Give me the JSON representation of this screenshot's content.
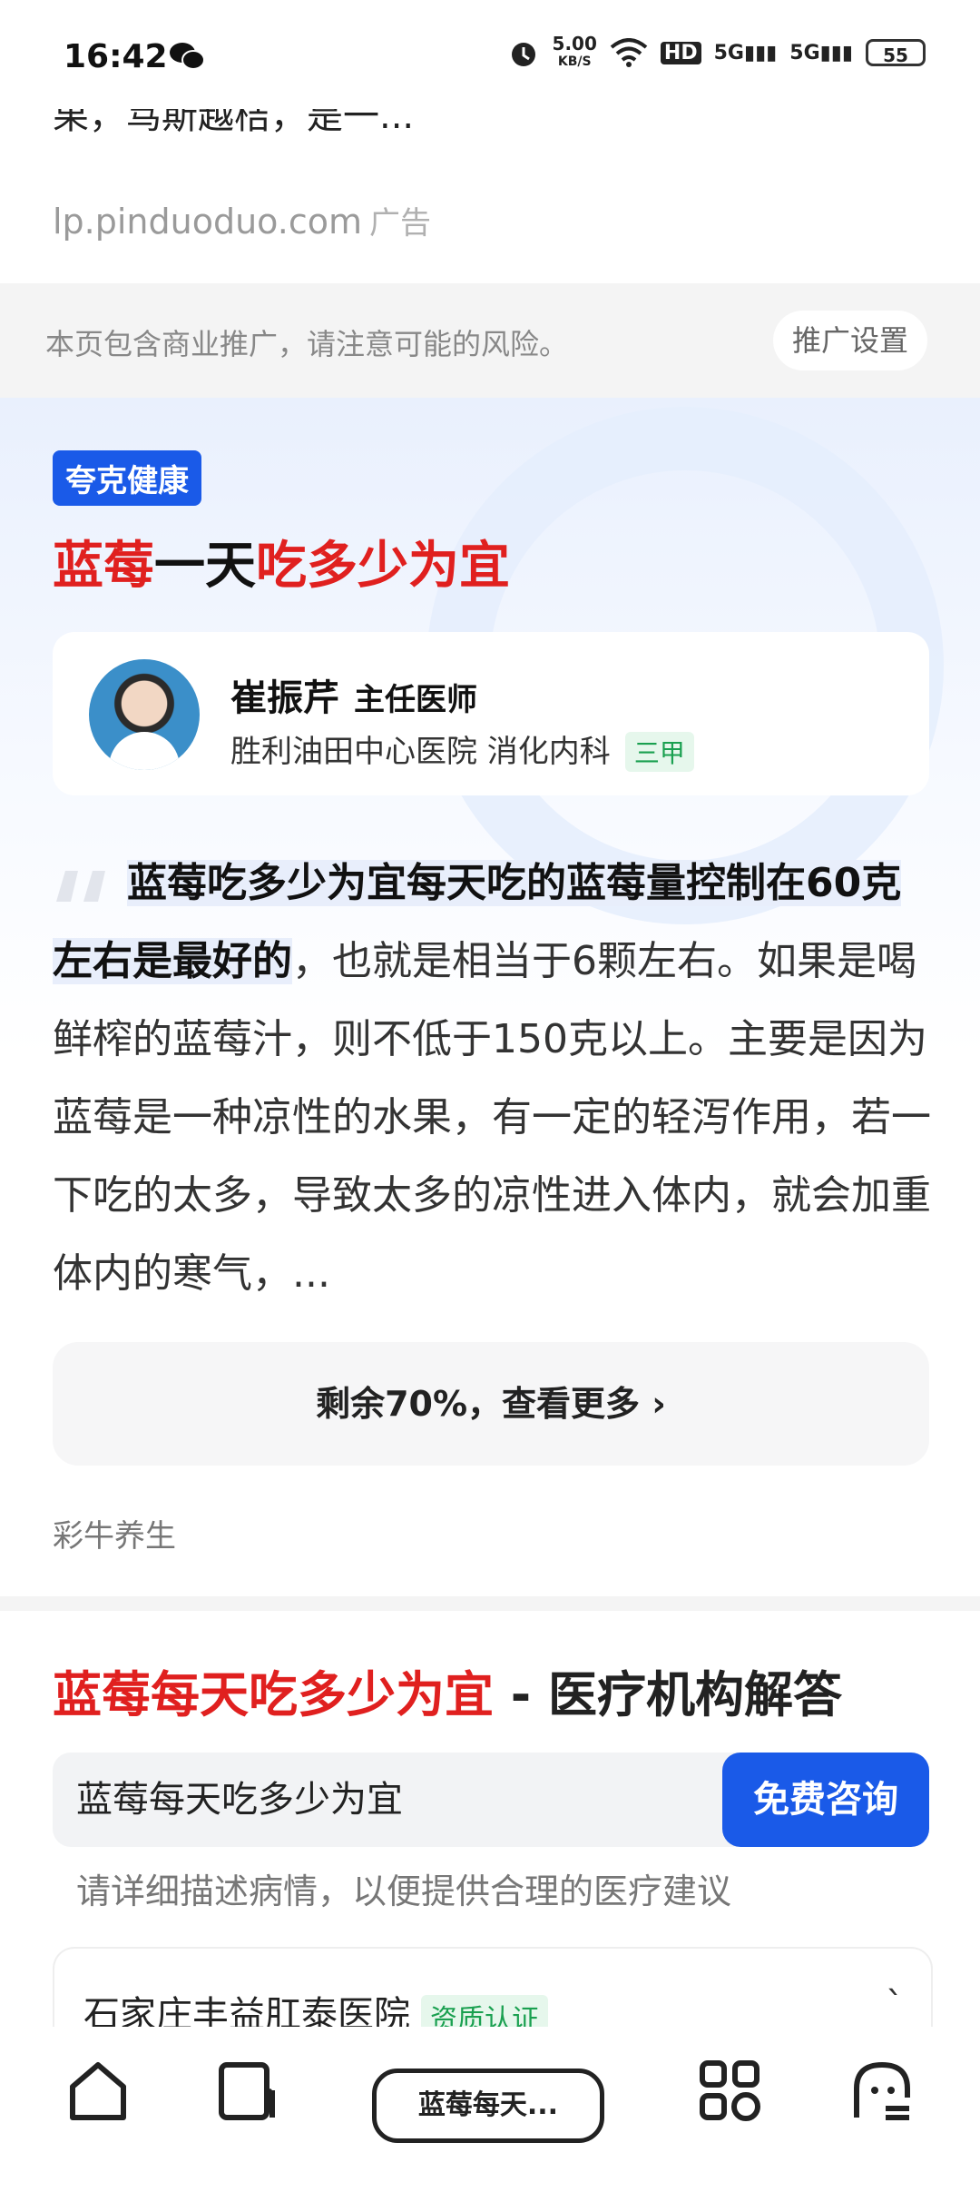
{
  "status_bar": {
    "time": "16:42",
    "network_speed": "5.00",
    "network_speed_unit": "KB/S",
    "hd": "HD",
    "signal1": "5G",
    "signal2": "5G",
    "battery": "55"
  },
  "ad": {
    "text": "果，笃斯越桔，是一...",
    "source": "lp.pinduoduo.com",
    "tag": "广告"
  },
  "notice": {
    "text": "本页包含商业推广，请注意可能的风险。",
    "button": "推广设置"
  },
  "health_card": {
    "badge": "夸克健康",
    "title_red_1": "蓝莓",
    "title_black": "一天",
    "title_red_2": "吃多少为宜",
    "doctor": {
      "name": "崔振芹",
      "title": "主任医师",
      "hospital": "胜利油田中心医院 消化内科",
      "level": "三甲"
    },
    "quote_highlight": "蓝莓吃多少为宜每天吃的蓝莓量控制在60克左右是最好的",
    "quote_rest": "，也就是相当于6颗左右。如果是喝鲜榨的蓝莓汁，则不低于150克以上。主要是因为蓝莓是一种凉性的水果，有一定的轻泻作用，若一下吃的太多，导致太多的凉性进入体内，就会加重体内的寒气，...",
    "more_button": "剩余70%，查看更多 ›",
    "source": "彩牛养生"
  },
  "medical": {
    "title_red": "蓝莓每天吃多少为宜",
    "title_black": " - 医疗机构解答",
    "input_value": "蓝莓每天吃多少为宜",
    "consult_button": "免费咨询",
    "hint": "请详细描述病情，以便提供合理的医疗建议",
    "hospital_name": "石家庄丰益肛泰医院",
    "hospital_cert": "资质认证"
  },
  "bottom_nav": {
    "current_tab_label": "蓝莓每天..."
  },
  "colors": {
    "accent_red": "#e0201f",
    "brand_blue": "#1a5ae8",
    "green_badge": "#1aa050"
  }
}
